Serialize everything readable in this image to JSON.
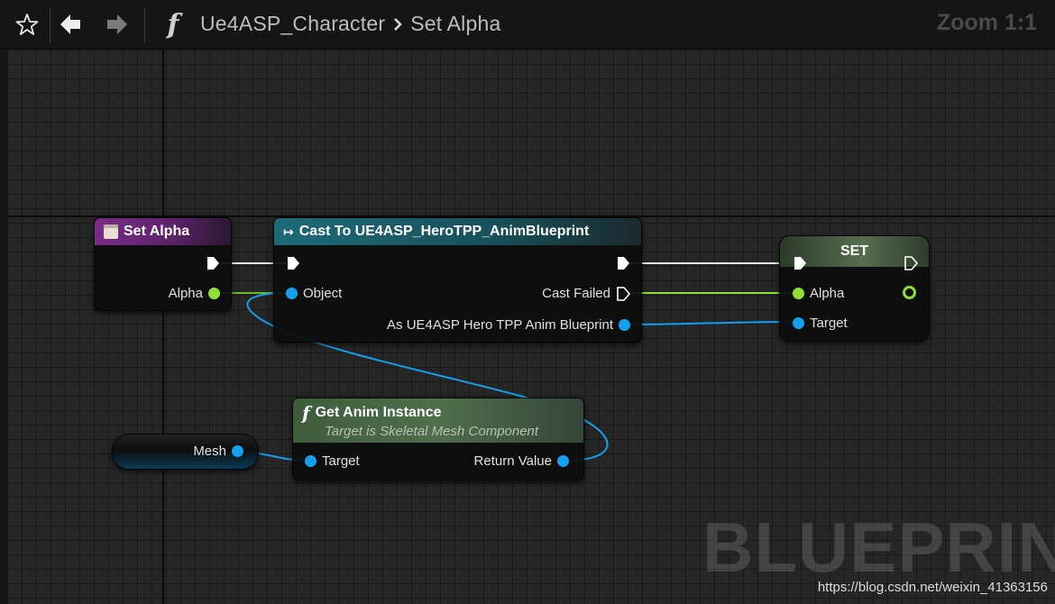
{
  "toolbar": {
    "breadcrumb_parent": "Ue4ASP_Character",
    "breadcrumb_current": "Set Alpha",
    "zoom": "Zoom 1:1",
    "icons": [
      "star-icon",
      "back-arrow-icon",
      "forward-arrow-icon",
      "function-icon"
    ]
  },
  "nodes": {
    "set_alpha_event": {
      "title": "Set Alpha",
      "header_color": "#7a2c88",
      "outputs": [
        "Alpha"
      ]
    },
    "cast": {
      "title": "Cast To UE4ASP_HeroTPP_AnimBlueprint",
      "header_color": "#1e6a78",
      "inputs": [
        "Object"
      ],
      "outputs": [
        "Cast Failed",
        "As UE4ASP Hero TPP Anim Blueprint"
      ]
    },
    "set": {
      "title": "SET",
      "header_color": "#445a40",
      "inputs": [
        "Alpha",
        "Target"
      ]
    },
    "get_anim_instance": {
      "title": "Get Anim Instance",
      "subtitle": "Target is Skeletal Mesh Component",
      "header_color": "#3e5c3a",
      "inputs": [
        "Target"
      ],
      "outputs": [
        "Return Value"
      ]
    },
    "mesh_getter": {
      "label": "Mesh"
    }
  },
  "colors": {
    "exec_wire": "#e8e8e8",
    "float_wire": "#8fe033",
    "object_wire": "#14a0f0",
    "accent_green": "#8fe033",
    "accent_blue": "#14a0f0"
  },
  "watermark": {
    "text": "BLUEPRINT",
    "url": "https://blog.csdn.net/weixin_41363156"
  }
}
